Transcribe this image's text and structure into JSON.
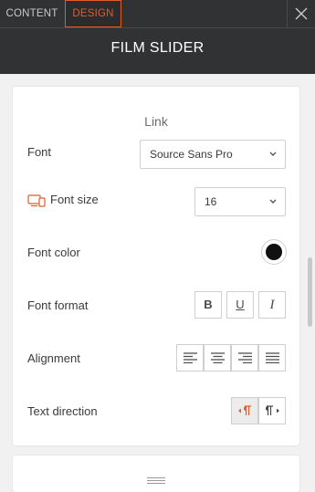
{
  "tabs": {
    "content": "CONTENT",
    "design": "DESIGN"
  },
  "header": {
    "title": "FILM SLIDER"
  },
  "section": {
    "title": "Link"
  },
  "font": {
    "label": "Font",
    "value": "Source Sans Pro"
  },
  "font_size": {
    "label": "Font size",
    "value": "16"
  },
  "font_color": {
    "label": "Font color",
    "value": "#111111"
  },
  "font_format": {
    "label": "Font format",
    "bold": "B",
    "underline": "U",
    "italic": "I"
  },
  "alignment": {
    "label": "Alignment",
    "options": [
      "left",
      "center",
      "right",
      "justify"
    ]
  },
  "text_direction": {
    "label": "Text direction",
    "selected": "rtl"
  },
  "colors": {
    "accent": "#e15c2a",
    "header_bg": "#303233"
  }
}
